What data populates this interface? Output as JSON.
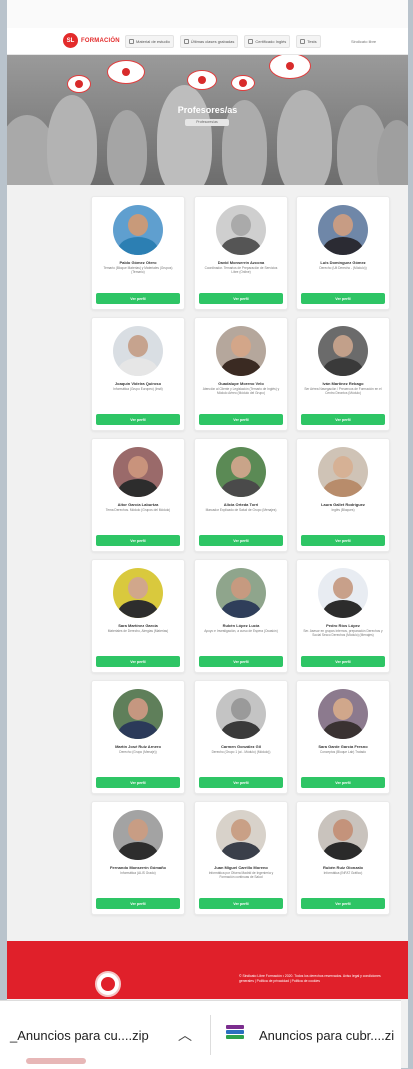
{
  "navbar": {
    "logo_text": "FORMACIÓN",
    "links": [
      {
        "label": "Material de estudio",
        "icon": "book-icon"
      },
      {
        "label": "Últimas clases grabadas",
        "icon": "video-icon"
      },
      {
        "label": "Certificado Inglés",
        "icon": "certificate-icon"
      },
      {
        "label": "Tests",
        "icon": "test-icon"
      }
    ],
    "user_label": "Sindicato libre"
  },
  "hero": {
    "title": "Profesores/as",
    "breadcrumb": "Profesores/as"
  },
  "teachers": [
    {
      "name": "Pablo Gómez Otero",
      "desc": "Temario (Bloque Materias) y Materiales (Grupos) (Temario)",
      "button": "Ver perfil",
      "skin": "#c89a7a",
      "shirt": "#2c7fb3",
      "bg": "#5f9fcf"
    },
    {
      "name": "David Monserrín Azcona",
      "desc": "Coordinador. Temarios de Preparación de Servicios Libre (Online)",
      "button": "Ver perfil",
      "skin": "#aaaaaa",
      "shirt": "#555555",
      "bg": "#cfcfcf"
    },
    {
      "name": "Luis Domínguez Gómez",
      "desc": "Derecho (Ult Derecho - (Módulo))",
      "button": "Ver perfil",
      "skin": "#c79c84",
      "shirt": "#2b2b33",
      "bg": "#6f87a8"
    },
    {
      "name": "Joaquín Videira Quiroso",
      "desc": "Informática (Grupo Europeo) (Insti)",
      "button": "Ver perfil",
      "skin": "#c6a38e",
      "shirt": "#e6e6e6",
      "bg": "#d9dee3"
    },
    {
      "name": "Guadalupe Moreno Velo",
      "desc": "Atención al Cliente y Legislación (Temario de Inglés) y Módulo Aéreo (Módulo del Grupo)",
      "button": "Ver perfil",
      "skin": "#d3a689",
      "shirt": "#3a2a22",
      "bg": "#b5a79c"
    },
    {
      "name": "Iván Martínez Rebago",
      "desc": "Ser Aérea Navegación / Preuercos de Formación en el Centro Deontos (Módulo)",
      "button": "Ver perfil",
      "skin": "#c2a08a",
      "shirt": "#3a3a3a",
      "bg": "#6b6b6b"
    },
    {
      "name": "Aitor García Laburtza",
      "desc": "Tema Derechos. Módulo (Grupos del Módulo)",
      "button": "Ver perfil",
      "skin": "#c9937c",
      "shirt": "#2d2d2d",
      "bg": "#9a6a6a"
    },
    {
      "name": "Alicia Orteda Torri",
      "desc": "Marcador Explicado de Salud de Grupo (Menajes)",
      "button": "Ver perfil",
      "skin": "#c9a489",
      "shirt": "#4a4a4a",
      "bg": "#5b8a55"
    },
    {
      "name": "Laura Gallet Rodríguez",
      "desc": "Inglés (Bloques)",
      "button": "Ver perfil",
      "skin": "#d6b195",
      "shirt": "#b88c6b",
      "bg": "#cfc3b6"
    },
    {
      "name": "Sara Martínez García",
      "desc": "Materiales de Derecho, Alergias (Materias)",
      "button": "Ver perfil",
      "skin": "#d1a78b",
      "shirt": "#2d2d2d",
      "bg": "#d9c93d"
    },
    {
      "name": "Rubén López Lucía",
      "desc": "Apoyo e Investigación, a curso de Espera (Ocasión)",
      "button": "Ver perfil",
      "skin": "#c69a80",
      "shirt": "#2f3e5a",
      "bg": "#8fa58c"
    },
    {
      "name": "Pedro Ríos López",
      "desc": "Ser. Asesor en grupos internos, preparación Derechos y Social Secco Derechos (Módulo) (Menajes)",
      "button": "Ver perfil",
      "skin": "#c8a08a",
      "shirt": "#2c2c2c",
      "bg": "#e8ecf2"
    },
    {
      "name": "Martín José Ruiz Arnero",
      "desc": "Derecho (Grupo (Menaje))",
      "button": "Ver perfil",
      "skin": "#c59780",
      "shirt": "#2b3a59",
      "bg": "#5f7f5a"
    },
    {
      "name": "Carmen González Gil",
      "desc": "Derecho (Grupo 1 (ai - Módulo) (Módulo))",
      "button": "Ver perfil",
      "skin": "#9a9a9a",
      "shirt": "#3a3a3a",
      "bg": "#c4c4c4"
    },
    {
      "name": "Sara Garde García Fresno",
      "desc": "Conceptos (Bloque Lab) Tratado",
      "button": "Ver perfil",
      "skin": "#d0a78b",
      "shirt": "#3a3232",
      "bg": "#8c7a8e"
    },
    {
      "name": "Fernando Monserrín Gómaño",
      "desc": "Informática (ALIS Grado)",
      "button": "Ver perfil",
      "skin": "#c89d84",
      "shirt": "#2d2d2d",
      "bg": "#a3a3a3"
    },
    {
      "name": "Juan Miguel Carrillo Moreno",
      "desc": "Informática por Ofuera Madrid de Ingeniería y Formación continuas de Salud",
      "button": "Ver perfil",
      "skin": "#c9a086",
      "shirt": "#3a3f4a",
      "bg": "#d8d2ca"
    },
    {
      "name": "Rubén Ruiz Gionzalo",
      "desc": "Informática (INFAT Gráfico)",
      "button": "Ver perfil",
      "skin": "#c4937b",
      "shirt": "#2a2a2a",
      "bg": "#c9c3bd"
    }
  ],
  "footer": {
    "text": "© Sindicato Libre Formación • 2020. Todos los derechos reservados. Aviso legal y condiciones generales | Política de privacidad | Política de cookies"
  },
  "downloads": [
    {
      "label": "_Anuncios para cu....zip"
    },
    {
      "label": "Anuncios para cubr....zi"
    }
  ],
  "colors": {
    "brand_red": "#e0202a",
    "button_green": "#2ec565"
  }
}
